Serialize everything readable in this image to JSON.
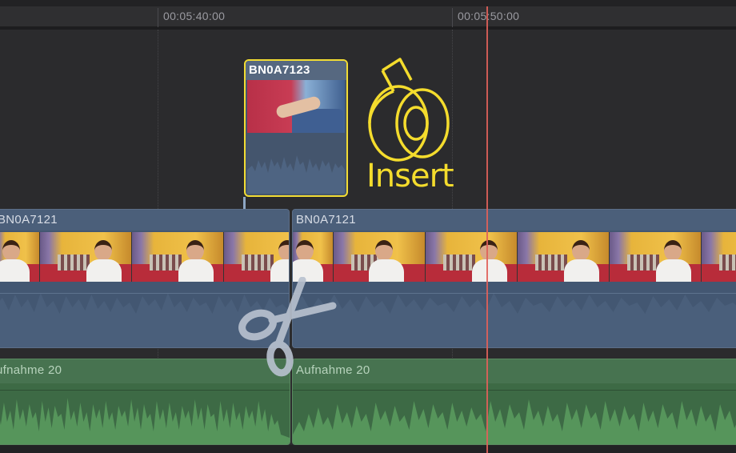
{
  "timeline": {
    "ruler": {
      "timecodes": [
        "00:05:40:00",
        "00:05:50:00"
      ]
    },
    "connected_clip": {
      "name": "BN0A7123",
      "state": "selected"
    },
    "annotation": {
      "label": "Insert",
      "icon": "tape-roll-icon",
      "color": "#f4dc2d"
    },
    "video_clips": [
      {
        "name": "BN0A7121"
      },
      {
        "name": "BN0A7121"
      }
    ],
    "audio_clips": [
      {
        "name": "ufnahme 20"
      },
      {
        "name": "Aufnahme 20"
      }
    ],
    "tool": {
      "icon": "blade-scissors-icon"
    },
    "colors": {
      "playhead": "#e0605a",
      "selection": "#f2dc33",
      "video_clip": "#435772",
      "audio_clip": "#3d6a45"
    }
  }
}
